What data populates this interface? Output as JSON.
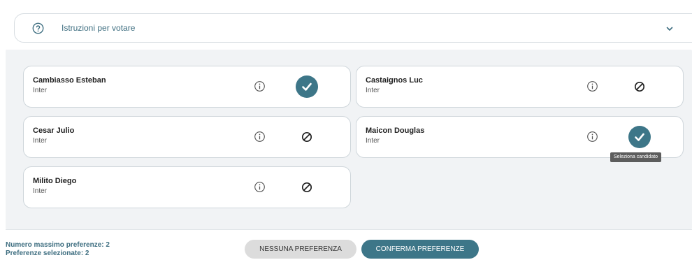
{
  "instructions": {
    "label": "Istruzioni per votare",
    "icon": "help-circle-icon",
    "chevron_icon": "chevron-down-icon",
    "color": "#3e6e80"
  },
  "candidates": [
    {
      "name": "Cambiasso Esteban",
      "team": "Inter",
      "selected": true
    },
    {
      "name": "Castaignos Luc",
      "team": "Inter",
      "selected": false
    },
    {
      "name": "Cesar Julio",
      "team": "Inter",
      "selected": false
    },
    {
      "name": "Maicon Douglas",
      "team": "Inter",
      "selected": true
    },
    {
      "name": "Milito Diego",
      "team": "Inter",
      "selected": false
    }
  ],
  "tooltip": {
    "text": "Seleziona candidato"
  },
  "footer": {
    "max_preferences": "Numero massimo preferenze: 2",
    "selected_preferences": "Preferenze selezionate: 2",
    "none_button": "NESSUNA PREFERENZA",
    "confirm_button": "CONFERMA PREFERENZE"
  },
  "colors": {
    "accent": "#3d7688",
    "panel_bg": "#f1f3f5",
    "secondary_button": "#dcdcdc"
  }
}
